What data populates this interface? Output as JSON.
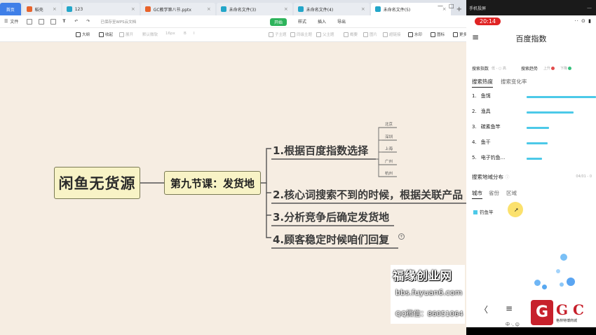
{
  "browser": {
    "tabs": [
      {
        "label": "首页",
        "kind": "home"
      },
      {
        "label": "稻壳",
        "icon_color": "#e8632b"
      },
      {
        "label": "123",
        "icon_color": "#23a6c9"
      },
      {
        "label": "GC教学第八节.pptx",
        "icon_color": "#e8632b"
      },
      {
        "label": "未命名文件(3)",
        "icon_color": "#23a6c9"
      },
      {
        "label": "未命名文件(4)",
        "icon_color": "#23a6c9"
      },
      {
        "label": "未命名文件(5)",
        "icon_color": "#23a6c9",
        "active": true
      }
    ],
    "add_tab": "+",
    "minimize": "—",
    "maximize": "□"
  },
  "menu": {
    "file_label": "文件",
    "saved_text": "已保存至WPS云文档",
    "tabs": [
      "开始",
      "样式",
      "插入",
      "导出"
    ],
    "active_tab": "开始"
  },
  "toolbar": {
    "items": [
      {
        "label": "大纲",
        "dim": false
      },
      {
        "label": "收起",
        "dim": false
      },
      {
        "label": "展开",
        "dim": true
      },
      {
        "label": "默认微软",
        "dim": true
      },
      {
        "label": "16px",
        "dim": true
      },
      {
        "label": "B",
        "dim": true
      },
      {
        "label": "I",
        "dim": true
      },
      {
        "label": "子主题",
        "dim": true
      },
      {
        "label": "同级主题",
        "dim": true
      },
      {
        "label": "父主题",
        "dim": true
      },
      {
        "label": "概要",
        "dim": true
      },
      {
        "label": "图片",
        "dim": true
      },
      {
        "label": "超链接",
        "dim": true
      },
      {
        "label": "水印",
        "dim": false
      },
      {
        "label": "图标",
        "dim": false
      },
      {
        "label": "更多",
        "dim": false
      }
    ]
  },
  "mindmap": {
    "root": "闲鱼无货源",
    "lesson": "第九节课：发货地",
    "branches": [
      "1.根据百度指数选择",
      "2.核心词搜索不到的时候，根据关联产品",
      "3.分析竞争后确定发货地",
      "4.顾客稳定时候咱们回复"
    ],
    "cities": [
      "北京",
      "深圳",
      "上海",
      "广州",
      "杭州"
    ],
    "collapse_symbol": "+"
  },
  "watermark": {
    "title": "福缘创业网",
    "url": "bbs.fuyuan6.com",
    "contact": "QQ微信：86051064"
  },
  "phone": {
    "window_title": "手机投屏",
    "window_controls": "—",
    "time": "20:14",
    "status_icons": "·· ⊙ ▮",
    "menu_icon": "≡",
    "app_title": "百度指数",
    "index_label": "搜索指数",
    "index_legend": "低 - ○ 高",
    "trend_label": "搜索趋势",
    "trend_up": "上升",
    "trend_down": "下降",
    "trend_up_color": "#e24b4b",
    "trend_down_color": "#34c17b",
    "tabs": [
      "搜索热度",
      "搜索变化率"
    ],
    "keywords": [
      {
        "rank": "1.",
        "name": "鱼饵",
        "bar": 1.0
      },
      {
        "rank": "2.",
        "name": "渔具",
        "bar": 0.68
      },
      {
        "rank": "3.",
        "name": "碳素鱼竿",
        "bar": 0.32
      },
      {
        "rank": "4.",
        "name": "鱼干",
        "bar": 0.3
      },
      {
        "rank": "5.",
        "name": "电子钓鱼...",
        "bar": 0.22
      }
    ],
    "region_title": "搜索地域分布",
    "region_info_icon": "ⓘ",
    "region_date": "04/01 - 0",
    "region_tabs": [
      "城市",
      "省份",
      "区域"
    ],
    "legend": "钓鱼竿",
    "nav": {
      "back": "〈",
      "home": "≡"
    },
    "logo": {
      "mark": "G",
      "text": "G C",
      "subtitle": "格林特博商城"
    },
    "ime": "中 ·, ☺"
  }
}
